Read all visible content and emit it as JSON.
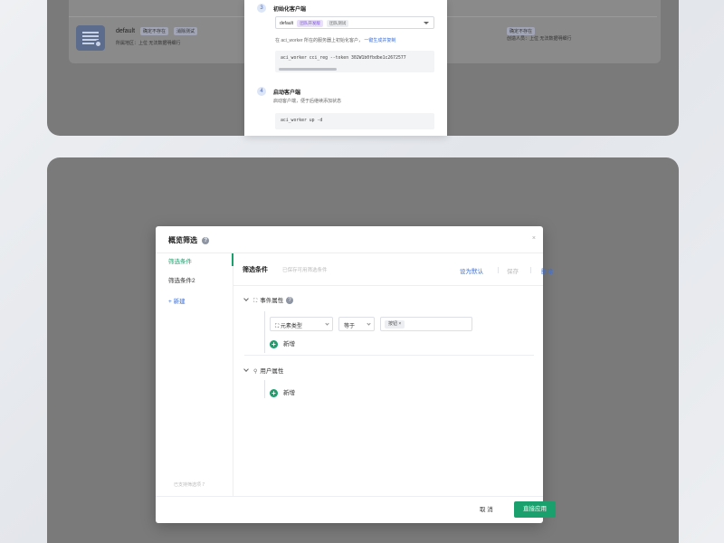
{
  "workspace": {
    "name": "default",
    "tags": [
      "确定不存在",
      "消除测试"
    ],
    "meta": "所属地区：上位    无法数据明细行   ",
    "right_tags": [
      "确定不存在"
    ],
    "right_meta": "创造人员：上位    无法数据明细行"
  },
  "setup": {
    "step1": {
      "num": "3",
      "title": "初始化客户端"
    },
    "selected_value": "default",
    "selected_tags": [
      "团队开发版",
      "团队测试"
    ],
    "hint_text": "在 aci_worker 所在的服务器上初始化客户，",
    "hint_link": "一键生成并复制",
    "command1": "aci_worker cci_reg --token 302W1b0fbdbe1c2672577",
    "step2": {
      "num": "4",
      "title": "启动客户端",
      "desc": "启动客户端，便于后继续添加状态"
    },
    "command2": "aci_worker up -d"
  },
  "modal": {
    "title": "概览筛选",
    "info_icon": "?",
    "close": "×",
    "sidebar": {
      "items": [
        "筛选条件",
        "筛选条件2"
      ],
      "new_label": "+ 新建",
      "footer": "已支持筛选项 7"
    },
    "content": {
      "title": "筛选条件",
      "subtitle": "已保存可用筛选条件",
      "actions": {
        "set_default": "设为默认",
        "save": "保存",
        "delete": "删除"
      },
      "event_group": {
        "label": "事件属性",
        "rule": {
          "field": "元素类型",
          "operator": "等于",
          "value": "按钮"
        },
        "add_label": "新增"
      },
      "user_group": {
        "label": "用户属性",
        "add_label": "新增"
      }
    },
    "footer": {
      "cancel": "取 消",
      "apply": "直接应用"
    }
  },
  "colors": {
    "accent": "#1aa06d",
    "link": "#3a6fd8",
    "overlay": "#7a7a7a"
  }
}
